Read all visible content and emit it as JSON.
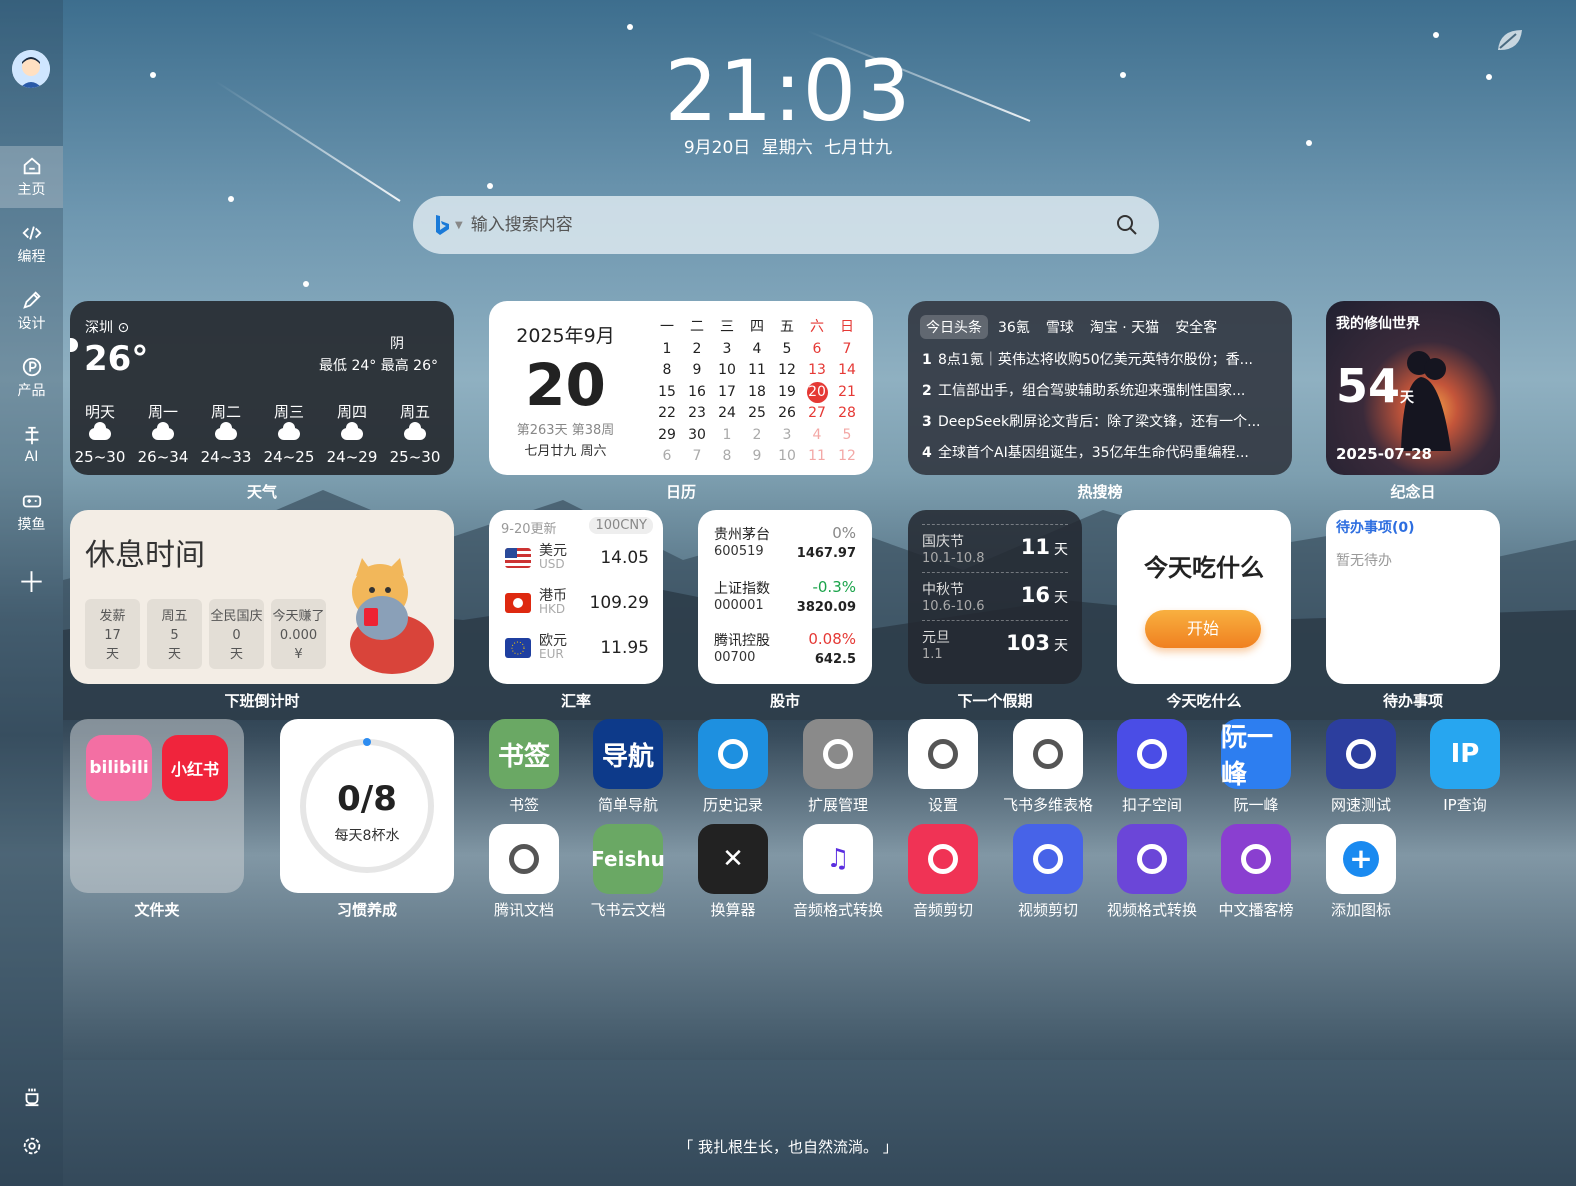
{
  "clock": {
    "time": "21:03",
    "date": "9月20日  星期六  七月廿九"
  },
  "search": {
    "placeholder": "输入搜索内容"
  },
  "sidebar": {
    "items": [
      {
        "label": "主页",
        "icon": "home-icon"
      },
      {
        "label": "编程",
        "icon": "code-icon"
      },
      {
        "label": "设计",
        "icon": "pen-icon"
      },
      {
        "label": "产品",
        "icon": "product-icon"
      },
      {
        "label": "AI",
        "icon": "ai-icon"
      },
      {
        "label": "摸鱼",
        "icon": "gamepad-icon"
      }
    ]
  },
  "weather": {
    "city": "深圳",
    "temp": "26°",
    "cond": "阴",
    "range": "最低 24° 最高 26°",
    "days": [
      {
        "name": "明天",
        "t": "25~30"
      },
      {
        "name": "周一",
        "t": "26~34"
      },
      {
        "name": "周二",
        "t": "24~33"
      },
      {
        "name": "周三",
        "t": "24~25"
      },
      {
        "name": "周四",
        "t": "24~29"
      },
      {
        "name": "周五",
        "t": "25~30"
      }
    ],
    "caption": "天气"
  },
  "calendar": {
    "month": "2025年9月",
    "day": "20",
    "week": "第263天 第38周",
    "lunar": "七月廿九 周六",
    "headers": [
      "一",
      "二",
      "三",
      "四",
      "五",
      "六",
      "日"
    ],
    "rows": [
      [
        "1",
        "2",
        "3",
        "4",
        "5",
        "6",
        "7"
      ],
      [
        "8",
        "9",
        "10",
        "11",
        "12",
        "13",
        "14"
      ],
      [
        "15",
        "16",
        "17",
        "18",
        "19",
        "20",
        "21"
      ],
      [
        "22",
        "23",
        "24",
        "25",
        "26",
        "27",
        "28"
      ],
      [
        "29",
        "30",
        "1",
        "2",
        "3",
        "4",
        "5"
      ],
      [
        "6",
        "7",
        "8",
        "9",
        "10",
        "11",
        "12"
      ]
    ],
    "caption": "日历"
  },
  "hot": {
    "tabs": [
      "今日头条",
      "36氪",
      "雪球",
      "淘宝 · 天猫",
      "安全客"
    ],
    "items": [
      "8点1氪｜英伟达将收购50亿美元英特尔股份；香...",
      "工信部出手，组合驾驶辅助系统迎来强制性国家...",
      "DeepSeek刷屏论文背后：除了梁文锋，还有一个...",
      "全球首个AI基因组诞生，35亿年生命代码重编程..."
    ],
    "caption": "热搜榜"
  },
  "anniv": {
    "title": "我的修仙世界",
    "days": "54",
    "unit": "天",
    "date": "2025-07-28",
    "caption": "纪念日"
  },
  "countdown": {
    "title": "休息时间",
    "boxes": [
      {
        "a": "发薪",
        "b": "17",
        "c": "天"
      },
      {
        "a": "周五",
        "b": "5",
        "c": "天"
      },
      {
        "a": "全民国庆",
        "b": "0",
        "c": "天"
      },
      {
        "a": "今天赚了",
        "b": "0.000",
        "c": "¥"
      }
    ],
    "caption": "下班倒计时"
  },
  "fx": {
    "updated": "9-20更新",
    "base": "100CNY",
    "rows": [
      {
        "name": "美元",
        "code": "USD",
        "val": "14.05"
      },
      {
        "name": "港币",
        "code": "HKD",
        "val": "109.29"
      },
      {
        "name": "欧元",
        "code": "EUR",
        "val": "11.95"
      }
    ],
    "caption": "汇率"
  },
  "stock": {
    "rows": [
      {
        "name": "贵州茅台",
        "code": "600519",
        "pct": "0%",
        "px": "1467.97",
        "color": "#888"
      },
      {
        "name": "上证指数",
        "code": "000001",
        "pct": "-0.3%",
        "px": "3820.09",
        "color": "#1aa34a"
      },
      {
        "name": "腾讯控股",
        "code": "00700",
        "pct": "0.08%",
        "px": "642.5",
        "color": "#e53935"
      }
    ],
    "caption": "股市"
  },
  "holiday": {
    "rows": [
      {
        "name": "国庆节",
        "dates": "10.1-10.8",
        "days": "11",
        "unit": "天"
      },
      {
        "name": "中秋节",
        "dates": "10.6-10.6",
        "days": "16",
        "unit": "天"
      },
      {
        "name": "元旦",
        "dates": "1.1",
        "days": "103",
        "unit": "天"
      }
    ],
    "caption": "下一个假期"
  },
  "eat": {
    "title": "今天吃什么",
    "button": "开始",
    "caption": "今天吃什么"
  },
  "todo": {
    "title": "待办事项(0)",
    "empty": "暂无待办",
    "caption": "待办事项"
  },
  "folder": {
    "apps": [
      "bilibili",
      "小红书"
    ],
    "caption": "文件夹"
  },
  "habit": {
    "progress": "0/8",
    "sub": "每天8杯水",
    "caption": "习惯养成"
  },
  "apps": [
    {
      "label": "书签",
      "text": "书签",
      "color": "#6aa864"
    },
    {
      "label": "简单导航",
      "text": "导航",
      "color": "#0d3a8a"
    },
    {
      "label": "历史记录",
      "text": "",
      "color": "#1e90e0"
    },
    {
      "label": "扩展管理",
      "text": "",
      "color": "#8a8a8a"
    },
    {
      "label": "设置",
      "text": "",
      "color": "#ffffff"
    },
    {
      "label": "飞书多维表格",
      "text": "",
      "color": "#ffffff"
    },
    {
      "label": "扣子空间",
      "text": "",
      "color": "#4a4de6"
    },
    {
      "label": "阮一峰",
      "text": "阮一峰",
      "color": "#2d7ef0"
    },
    {
      "label": "网速测试",
      "text": "",
      "color": "#2c3e9e"
    },
    {
      "label": "IP查询",
      "text": "IP",
      "color": "#27a6f0"
    },
    {
      "label": "腾讯文档",
      "text": "",
      "color": "#ffffff"
    },
    {
      "label": "飞书云文档",
      "text": "Feishu",
      "color": "#6aa864"
    },
    {
      "label": "换算器",
      "text": "✕",
      "color": "#222222"
    },
    {
      "label": "音频格式转换",
      "text": "♫",
      "color": "#ffffff"
    },
    {
      "label": "音频剪切",
      "text": "",
      "color": "#f03355"
    },
    {
      "label": "视频剪切",
      "text": "",
      "color": "#4763e8"
    },
    {
      "label": "视频格式转换",
      "text": "",
      "color": "#6b46d8"
    },
    {
      "label": "中文播客榜",
      "text": "",
      "color": "#8a3fd0"
    },
    {
      "label": "添加图标",
      "text": "+",
      "color": "#ffffff"
    }
  ],
  "quote": "「 我扎根生长，也自然流淌。 」"
}
